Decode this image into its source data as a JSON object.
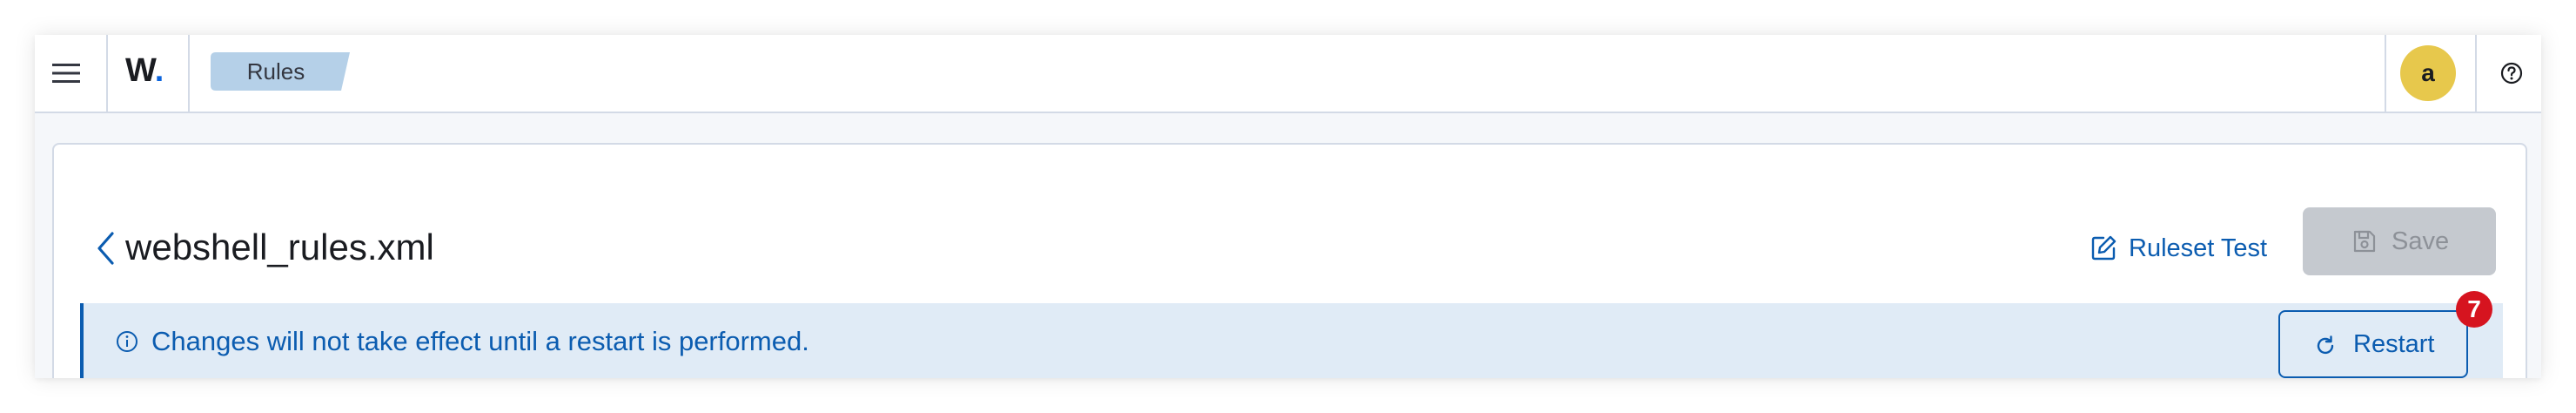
{
  "header": {
    "logo_text": "W",
    "logo_dot": ".",
    "breadcrumb": "Rules",
    "avatar_initial": "a",
    "menu_icon": "hamburger-menu-icon",
    "help_icon": "question-circle-icon"
  },
  "page": {
    "file_title": "webshell_rules.xml",
    "back_icon": "chevron-left-icon",
    "ruleset_test_label": "Ruleset Test",
    "ruleset_test_icon": "edit-document-icon",
    "save_label": "Save",
    "save_icon": "floppy-disk-icon"
  },
  "callout": {
    "icon": "info-circle-icon",
    "message": "Changes will not take effect until a restart is performed.",
    "restart_label": "Restart",
    "restart_icon": "refresh-icon",
    "restart_badge": "7"
  },
  "colors": {
    "accent": "#0b5cb0",
    "callout_bg": "#e0ebf6",
    "avatar_bg": "#e7c84c",
    "breadcrumb_bg": "#b5d0e8",
    "badge_bg": "#d6141f",
    "disabled_bg": "#c5c9cf"
  }
}
